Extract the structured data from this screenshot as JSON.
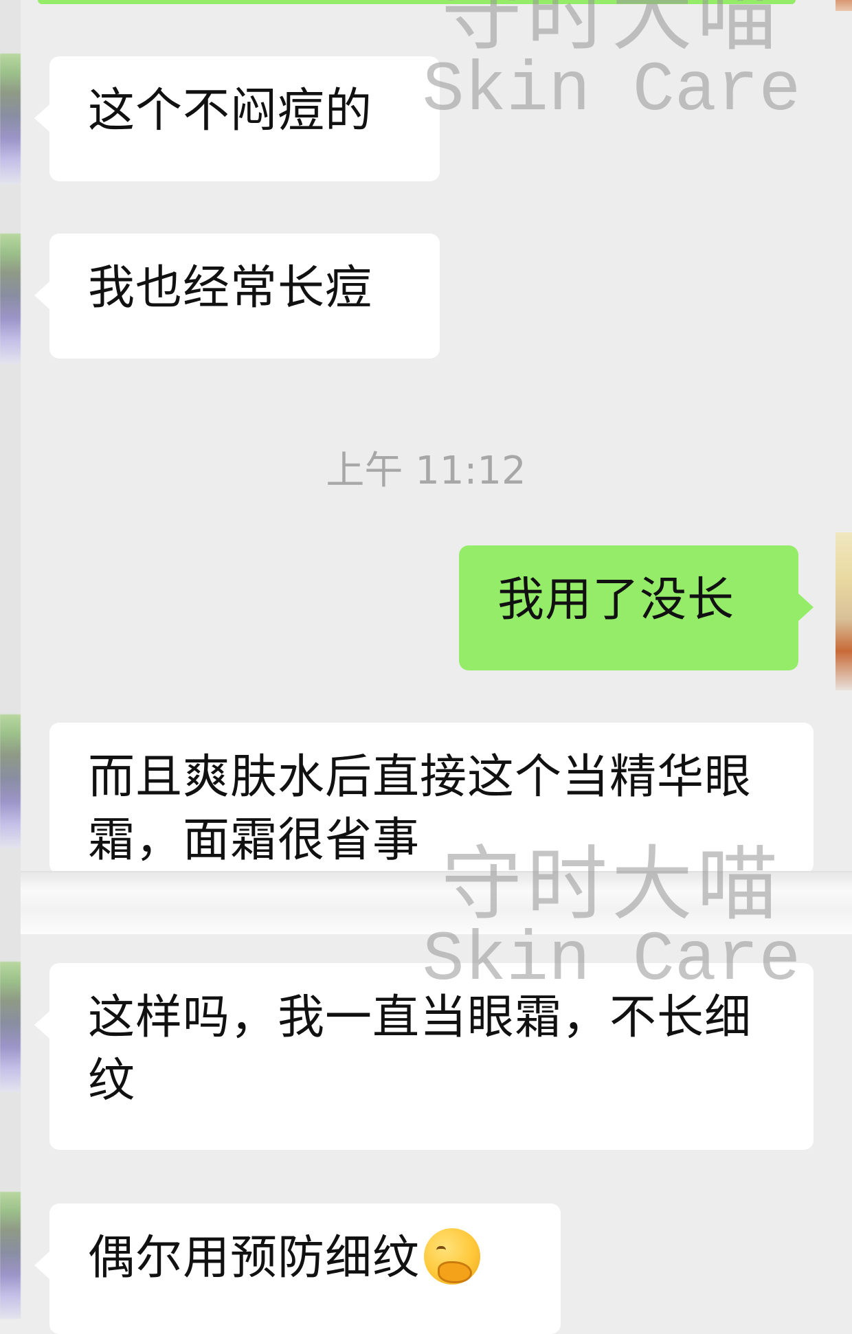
{
  "chat": {
    "timestamp": "上午 11:12",
    "messages": [
      {
        "side": "in",
        "text": "这个不闷痘的"
      },
      {
        "side": "in",
        "text": "我也经常长痘"
      },
      {
        "side": "out",
        "text": "我用了没长"
      },
      {
        "side": "in",
        "text": "而且爽肤水后直接这个当精华眼霜，面霜很省事"
      },
      {
        "side": "in",
        "text": "这样吗，我一直当眼霜，不长细纹"
      },
      {
        "side": "in",
        "text": "偶尔用预防细纹",
        "emoji": "thinking-laugh-emoji"
      }
    ]
  },
  "watermark": {
    "line1": "守时大喵",
    "line2": "Skin Care"
  },
  "colors": {
    "background": "#ededed",
    "incoming_bubble": "#ffffff",
    "outgoing_bubble": "#95ec69",
    "timestamp_text": "#a7a7a7"
  }
}
